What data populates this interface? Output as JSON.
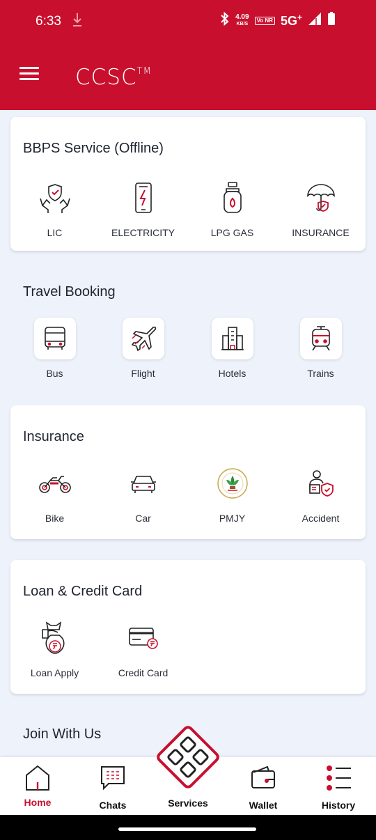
{
  "status_bar": {
    "time": "6:33",
    "speed_value": "4.09",
    "speed_unit": "KB/S",
    "volte": "Vo NR",
    "network": "5G",
    "network_sup": "+"
  },
  "header": {
    "logo": "CCSC",
    "logo_mark": "TM",
    "accent_color": "#c8102e"
  },
  "sections": {
    "bbps": {
      "title": "BBPS Service (Offline)",
      "items": [
        {
          "label": "LIC",
          "icon": "hands-shield-icon"
        },
        {
          "label": "ELECTRICITY",
          "icon": "phone-lightning-icon"
        },
        {
          "label": "LPG GAS",
          "icon": "gas-cylinder-icon"
        },
        {
          "label": "INSURANCE",
          "icon": "umbrella-shield-icon"
        }
      ]
    },
    "travel": {
      "title": "Travel Booking",
      "items": [
        {
          "label": "Bus",
          "icon": "bus-icon"
        },
        {
          "label": "Flight",
          "icon": "airplane-icon"
        },
        {
          "label": "Hotels",
          "icon": "hotel-building-icon"
        },
        {
          "label": "Trains",
          "icon": "train-icon"
        }
      ]
    },
    "insurance": {
      "title": "Insurance",
      "items": [
        {
          "label": "Bike",
          "icon": "motorbike-icon"
        },
        {
          "label": "Car",
          "icon": "car-icon"
        },
        {
          "label": "PMJY",
          "icon": "pmjay-logo-icon"
        },
        {
          "label": "Accident",
          "icon": "person-shield-icon"
        }
      ]
    },
    "loan": {
      "title": "Loan & Credit Card",
      "items": [
        {
          "label": "Loan Apply",
          "icon": "money-bag-icon"
        },
        {
          "label": "Credit Card",
          "icon": "credit-card-rupee-icon"
        }
      ]
    },
    "join": {
      "title": "Join With Us"
    }
  },
  "bottom_nav": {
    "home": "Home",
    "chats": "Chats",
    "services": "Services",
    "wallet": "Wallet",
    "history": "History"
  }
}
